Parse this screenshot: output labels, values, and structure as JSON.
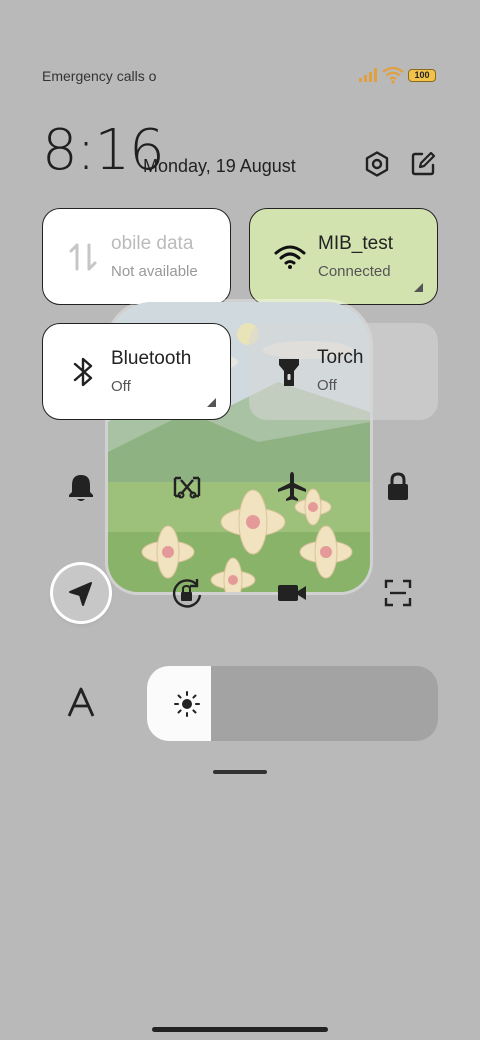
{
  "status_bar": {
    "carrier_text": "Emergency calls o",
    "battery_level": "100",
    "signal_color": "#e0a040",
    "wifi_color": "#e0a040"
  },
  "header": {
    "time": "8:16",
    "date": "Monday, 19 August"
  },
  "tiles": {
    "mobile": {
      "title": "obile data",
      "subtitle": "Not available"
    },
    "wifi": {
      "title": "MIB_test",
      "subtitle": "Connected",
      "color": "#d3e3b0"
    },
    "bluetooth": {
      "title": "Bluetooth",
      "subtitle": "Off"
    },
    "torch": {
      "title": "Torch",
      "subtitle": "Off"
    }
  },
  "toggles": [
    "bell-icon",
    "screenshot-icon",
    "airplane-icon",
    "lock-icon",
    "location-icon",
    "rotation-lock-icon",
    "video-icon",
    "scan-icon"
  ],
  "brightness": {
    "level": 0.22
  }
}
